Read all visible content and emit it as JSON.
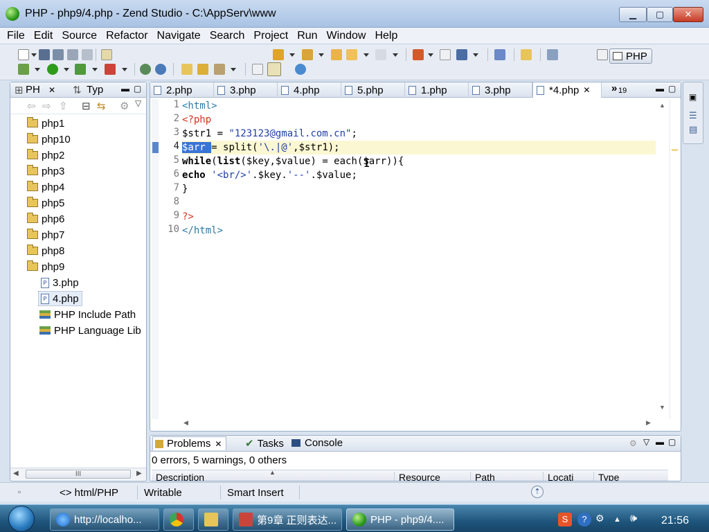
{
  "window": {
    "title": "PHP - php9/4.php - Zend Studio - C:\\AppServ\\www",
    "min_label": "▁",
    "max_label": "▢",
    "close_label": "✕"
  },
  "menu": [
    "File",
    "Edit",
    "Source",
    "Refactor",
    "Navigate",
    "Search",
    "Project",
    "Run",
    "Window",
    "Help"
  ],
  "perspective": {
    "label": "PHP"
  },
  "left_panel": {
    "tab1": "PH",
    "tab2": "Typ",
    "tree": [
      {
        "label": "php1",
        "type": "folder"
      },
      {
        "label": "php10",
        "type": "folder"
      },
      {
        "label": "php2",
        "type": "folder"
      },
      {
        "label": "php3",
        "type": "folder"
      },
      {
        "label": "php4",
        "type": "folder"
      },
      {
        "label": "php5",
        "type": "folder"
      },
      {
        "label": "php6",
        "type": "folder"
      },
      {
        "label": "php7",
        "type": "folder"
      },
      {
        "label": "php8",
        "type": "folder"
      },
      {
        "label": "php9",
        "type": "folder"
      },
      {
        "label": "3.php",
        "type": "file"
      },
      {
        "label": "4.php",
        "type": "file",
        "selected": true
      },
      {
        "label": "PHP Include Path",
        "type": "lib"
      },
      {
        "label": "PHP Language Lib",
        "type": "lib"
      }
    ],
    "scroll_label": "III"
  },
  "editor": {
    "tabs": [
      "2.php",
      "3.php",
      "4.php",
      "5.php",
      "1.php",
      "3.php",
      "*4.php"
    ],
    "active_tab": "*4.php",
    "overflow": "»",
    "overflow_count": "19",
    "line_numbers": [
      "1",
      "2",
      "3",
      "4",
      "5",
      "6",
      "7",
      "8",
      "9",
      "10"
    ],
    "code": {
      "l1": "<html>",
      "l2": "<?php",
      "l3a": "$str1 = ",
      "l3b": "\"123123@gmail.com.cn\"",
      "l3c": ";",
      "l4sel": "$arr ",
      "l4a": "= split(",
      "l4b": "'\\.|@'",
      "l4c": ",$str1);",
      "l5kw": "while",
      "l5a": "(",
      "l5kw2": "list",
      "l5b": "($key,$value) = each($arr)){",
      "l6kw": "echo",
      "l6a": " ",
      "l6b": "'<br/>'",
      "l6c": ".$key.",
      "l6d": "'--'",
      "l6e": ".$value;",
      "l7": "}",
      "l9": "?>",
      "l10": "</html>"
    }
  },
  "bottom_panel": {
    "tabs": [
      "Problems",
      "Tasks",
      "Console"
    ],
    "summary": "0 errors, 5 warnings, 0 others",
    "columns": [
      "Description",
      "Resource",
      "Path",
      "Locati",
      "Type"
    ]
  },
  "status": {
    "content_type": "<> html/PHP",
    "writable": "Writable",
    "insert_mode": "Smart Insert"
  },
  "taskbar": {
    "tasks": [
      "http://localho...",
      "",
      "",
      "第9章 正则表达...",
      "PHP - php9/4...."
    ],
    "clock": "21:56"
  },
  "colors": {
    "accent": "#3a74d8",
    "current_line": "#fbf7d2",
    "tag": "#2a7aa5",
    "php_delim": "#d2321e"
  }
}
